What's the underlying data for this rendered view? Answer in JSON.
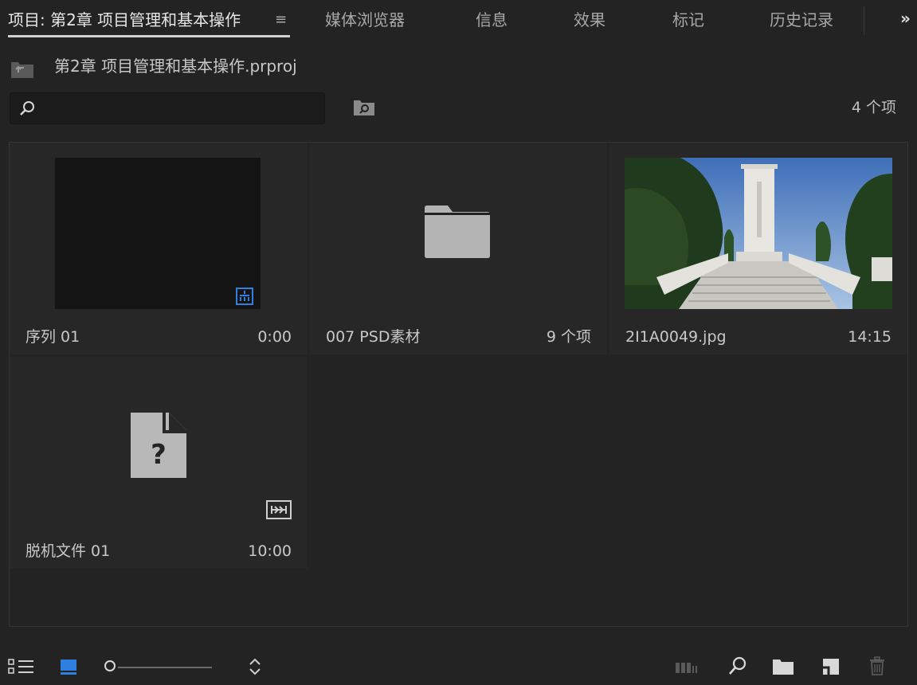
{
  "tabs": {
    "project": "项目: 第2章 项目管理和基本操作",
    "media_browser": "媒体浏览器",
    "info": "信息",
    "effects": "效果",
    "markers": "标记",
    "history": "历史记录",
    "menu_glyph": "≡",
    "overflow_glyph": "»"
  },
  "project": {
    "path": "第2章 项目管理和基本操作.prproj"
  },
  "search": {
    "value": "",
    "placeholder": ""
  },
  "item_count": "4 个项",
  "items": [
    {
      "name": "序列 01",
      "meta": "0:00",
      "kind": "sequence"
    },
    {
      "name": "007 PSD素材",
      "meta": "9 个项",
      "kind": "bin"
    },
    {
      "name": "2I1A0049.jpg",
      "meta": "14:15",
      "kind": "image"
    },
    {
      "name": "脱机文件 01",
      "meta": "10:00",
      "kind": "offline-file"
    }
  ],
  "toolbar": {
    "list_view_icon": "list-view-icon",
    "icon_view_icon": "icon-view-icon",
    "zoom_level": 0.0,
    "sort_icon": "sort-icon",
    "automate_icon": "automate-to-sequence-icon",
    "find_icon": "find-icon",
    "new_bin_icon": "new-bin-icon",
    "new_item_icon": "new-item-icon",
    "clear_icon": "trash-icon"
  },
  "colors": {
    "background": "#232323",
    "tile": "#272727",
    "accent_blue": "#2f7fe0",
    "folder": "#b4b4b4"
  }
}
